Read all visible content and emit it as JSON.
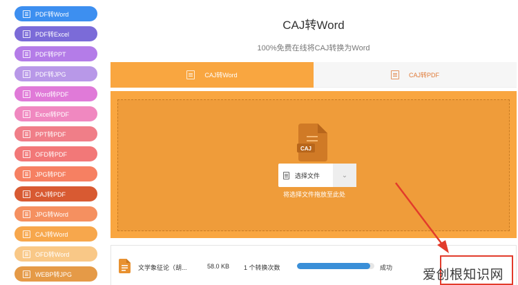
{
  "sidebar": {
    "items": [
      {
        "label": "PDF转Word",
        "color": "#3d8ff0"
      },
      {
        "label": "PDF转Excel",
        "color": "#7b6bd8"
      },
      {
        "label": "PDF转PPT",
        "color": "#b47ce8"
      },
      {
        "label": "PDF转JPG",
        "color": "#b898e8"
      },
      {
        "label": "Word转PDF",
        "color": "#e07ad8"
      },
      {
        "label": "Excel转PDF",
        "color": "#f088c0"
      },
      {
        "label": "PPT转PDF",
        "color": "#f07e88"
      },
      {
        "label": "OFD转PDF",
        "color": "#f27878"
      },
      {
        "label": "JPG转PDF",
        "color": "#f68062"
      },
      {
        "label": "CAJ转PDF",
        "color": "#d85a32"
      },
      {
        "label": "JPG转Word",
        "color": "#f59060"
      },
      {
        "label": "CAJ转Word",
        "color": "#f7a74c"
      },
      {
        "label": "OFD转Word",
        "color": "#f9c887"
      },
      {
        "label": "WEBP转JPG",
        "color": "#e59a47"
      }
    ]
  },
  "header": {
    "title": "CAJ转Word",
    "subtitle": "100%免费在线将CAJ转换为Word"
  },
  "tabs": [
    {
      "label": "CAJ转Word",
      "active": true
    },
    {
      "label": "CAJ转PDF",
      "active": false
    }
  ],
  "upload": {
    "file_icon_label": "CAJ",
    "select_label": "选择文件",
    "drop_hint": "将选择文件拖放至此处"
  },
  "file": {
    "name": "文学象征论（胡...",
    "size": "58.0 KB",
    "count": "1 个转换次数",
    "progress": 0.95,
    "status": "成功"
  },
  "watermark": "爱创根知识网",
  "colors": {
    "accent": "#f9a640",
    "progress": "#3a8fd8",
    "annotation": "#e23b2b"
  }
}
